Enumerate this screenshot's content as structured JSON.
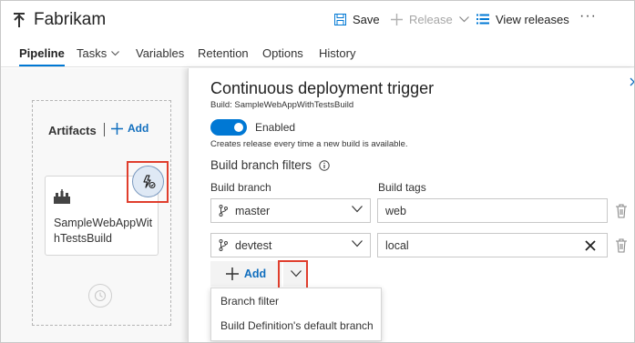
{
  "header": {
    "app_title": "Fabrikam",
    "toolbar": {
      "save_label": "Save",
      "release_label": "Release",
      "view_releases_label": "View releases",
      "more_label": "···"
    },
    "tabs": [
      {
        "label": "Pipeline",
        "active": true
      },
      {
        "label": "Tasks",
        "active": false
      },
      {
        "label": "Variables",
        "active": false
      },
      {
        "label": "Retention",
        "active": false
      },
      {
        "label": "Options",
        "active": false
      },
      {
        "label": "History",
        "active": false
      }
    ]
  },
  "artifacts": {
    "title": "Artifacts",
    "add_label": "Add",
    "card_name": "SampleWebAppWithTestsBuild"
  },
  "panel": {
    "title": "Continuous deployment trigger",
    "build_line": "Build: SampleWebAppWithTestsBuild",
    "toggle": {
      "label": "Enabled",
      "on": true
    },
    "description": "Creates release every time a new build is available.",
    "filters_heading": "Build branch filters",
    "col_branch": "Build branch",
    "col_tags": "Build tags",
    "rows": [
      {
        "branch": "master",
        "tags": "web"
      },
      {
        "branch": "devtest",
        "tags": "local"
      }
    ],
    "add_label": "Add",
    "menu": [
      "Branch filter",
      "Build Definition's default branch"
    ]
  },
  "colors": {
    "accent": "#0078d4",
    "link": "#106ebe",
    "highlight": "#e03e2d"
  }
}
